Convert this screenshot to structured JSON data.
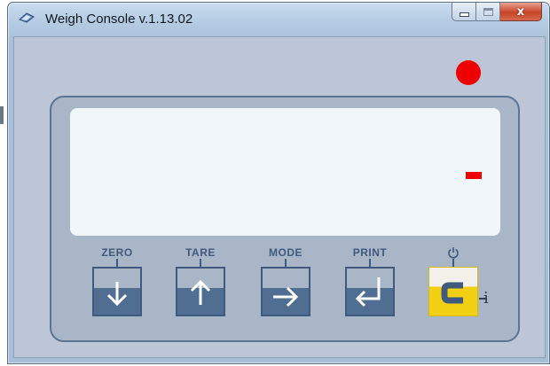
{
  "window": {
    "title": "Weigh Console v.1.13.02",
    "icon": "app-icon",
    "controls": {
      "minimize": "minimize-icon",
      "maximize": "maximize-icon",
      "close": "x"
    }
  },
  "status_led": {
    "color": "#ee0000"
  },
  "display": {
    "reading_symbol": "-"
  },
  "keys": [
    {
      "label": "ZERO",
      "icon": "arrow-down-icon"
    },
    {
      "label": "TARE",
      "icon": "arrow-up-icon"
    },
    {
      "label": "MODE",
      "icon": "arrow-right-icon"
    },
    {
      "label": "PRINT",
      "icon": "enter-return-icon"
    }
  ],
  "power_key": {
    "icon": "power-icon",
    "label": "C",
    "suffix": "i",
    "accent": "#f1cf12"
  },
  "colors": {
    "panel_border": "#5b7492",
    "key_blue": "#4f6e92",
    "led_red": "#ee0000"
  }
}
